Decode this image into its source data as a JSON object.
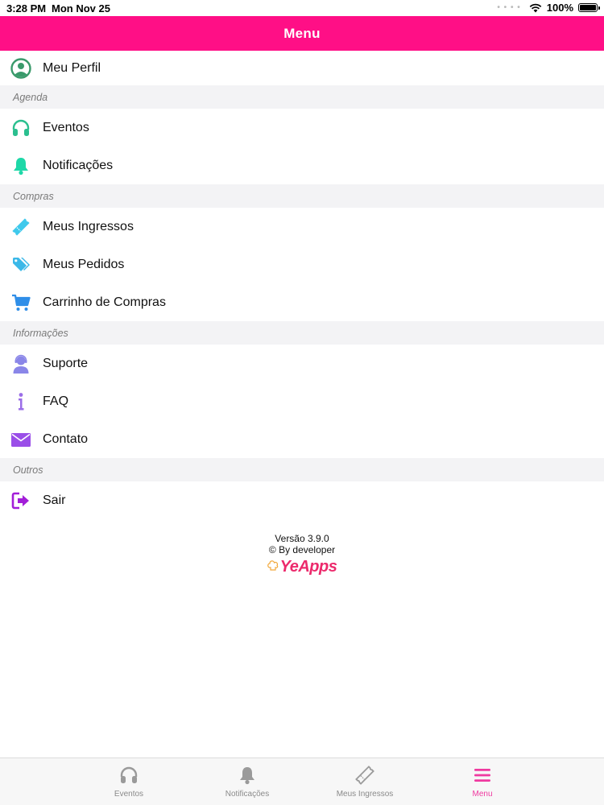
{
  "status_bar": {
    "time": "3:28 PM",
    "date": "Mon Nov 25",
    "battery": "100%"
  },
  "header": {
    "title": "Menu"
  },
  "menu": {
    "profile": {
      "label": "Meu Perfil",
      "icon": "user-circle-icon",
      "color": "#3a9a6b"
    },
    "sections": [
      {
        "title": "Agenda",
        "items": [
          {
            "label": "Eventos",
            "icon": "headphones-icon",
            "color": "#2bbf8f"
          },
          {
            "label": "Notificações",
            "icon": "bell-icon",
            "color": "#1ed8a8"
          }
        ]
      },
      {
        "title": "Compras",
        "items": [
          {
            "label": "Meus Ingressos",
            "icon": "ticket-icon",
            "color": "#3fc9ec"
          },
          {
            "label": "Meus Pedidos",
            "icon": "tags-icon",
            "color": "#3bb8e8"
          },
          {
            "label": "Carrinho de Compras",
            "icon": "cart-icon",
            "color": "#2f8ee8"
          }
        ]
      },
      {
        "title": "Informações",
        "items": [
          {
            "label": "Suporte",
            "icon": "support-agent-icon",
            "color": "#8a86e8"
          },
          {
            "label": "FAQ",
            "icon": "info-icon",
            "color": "#9b6ee8"
          },
          {
            "label": "Contato",
            "icon": "envelope-icon",
            "color": "#9a4ee8"
          }
        ]
      },
      {
        "title": "Outros",
        "items": [
          {
            "label": "Sair",
            "icon": "sign-out-icon",
            "color": "#a21ed8"
          }
        ]
      }
    ]
  },
  "footer": {
    "version": "Versão 3.9.0",
    "credit": "© By developer",
    "logo_text": "YeApps",
    "logo_color": "#ec2a6c"
  },
  "tab_bar": {
    "tabs": [
      {
        "label": "Eventos",
        "icon": "headphones-icon",
        "active": false
      },
      {
        "label": "Notificações",
        "icon": "bell-icon",
        "active": false
      },
      {
        "label": "Meus Ingressos",
        "icon": "ticket-icon",
        "active": false
      },
      {
        "label": "Menu",
        "icon": "menu-icon",
        "active": true
      }
    ],
    "active_color": "#ef3aa0",
    "inactive_color": "#8a8a8a"
  },
  "colors": {
    "header": "#ff0f86",
    "section_bg": "#f3f3f5"
  }
}
